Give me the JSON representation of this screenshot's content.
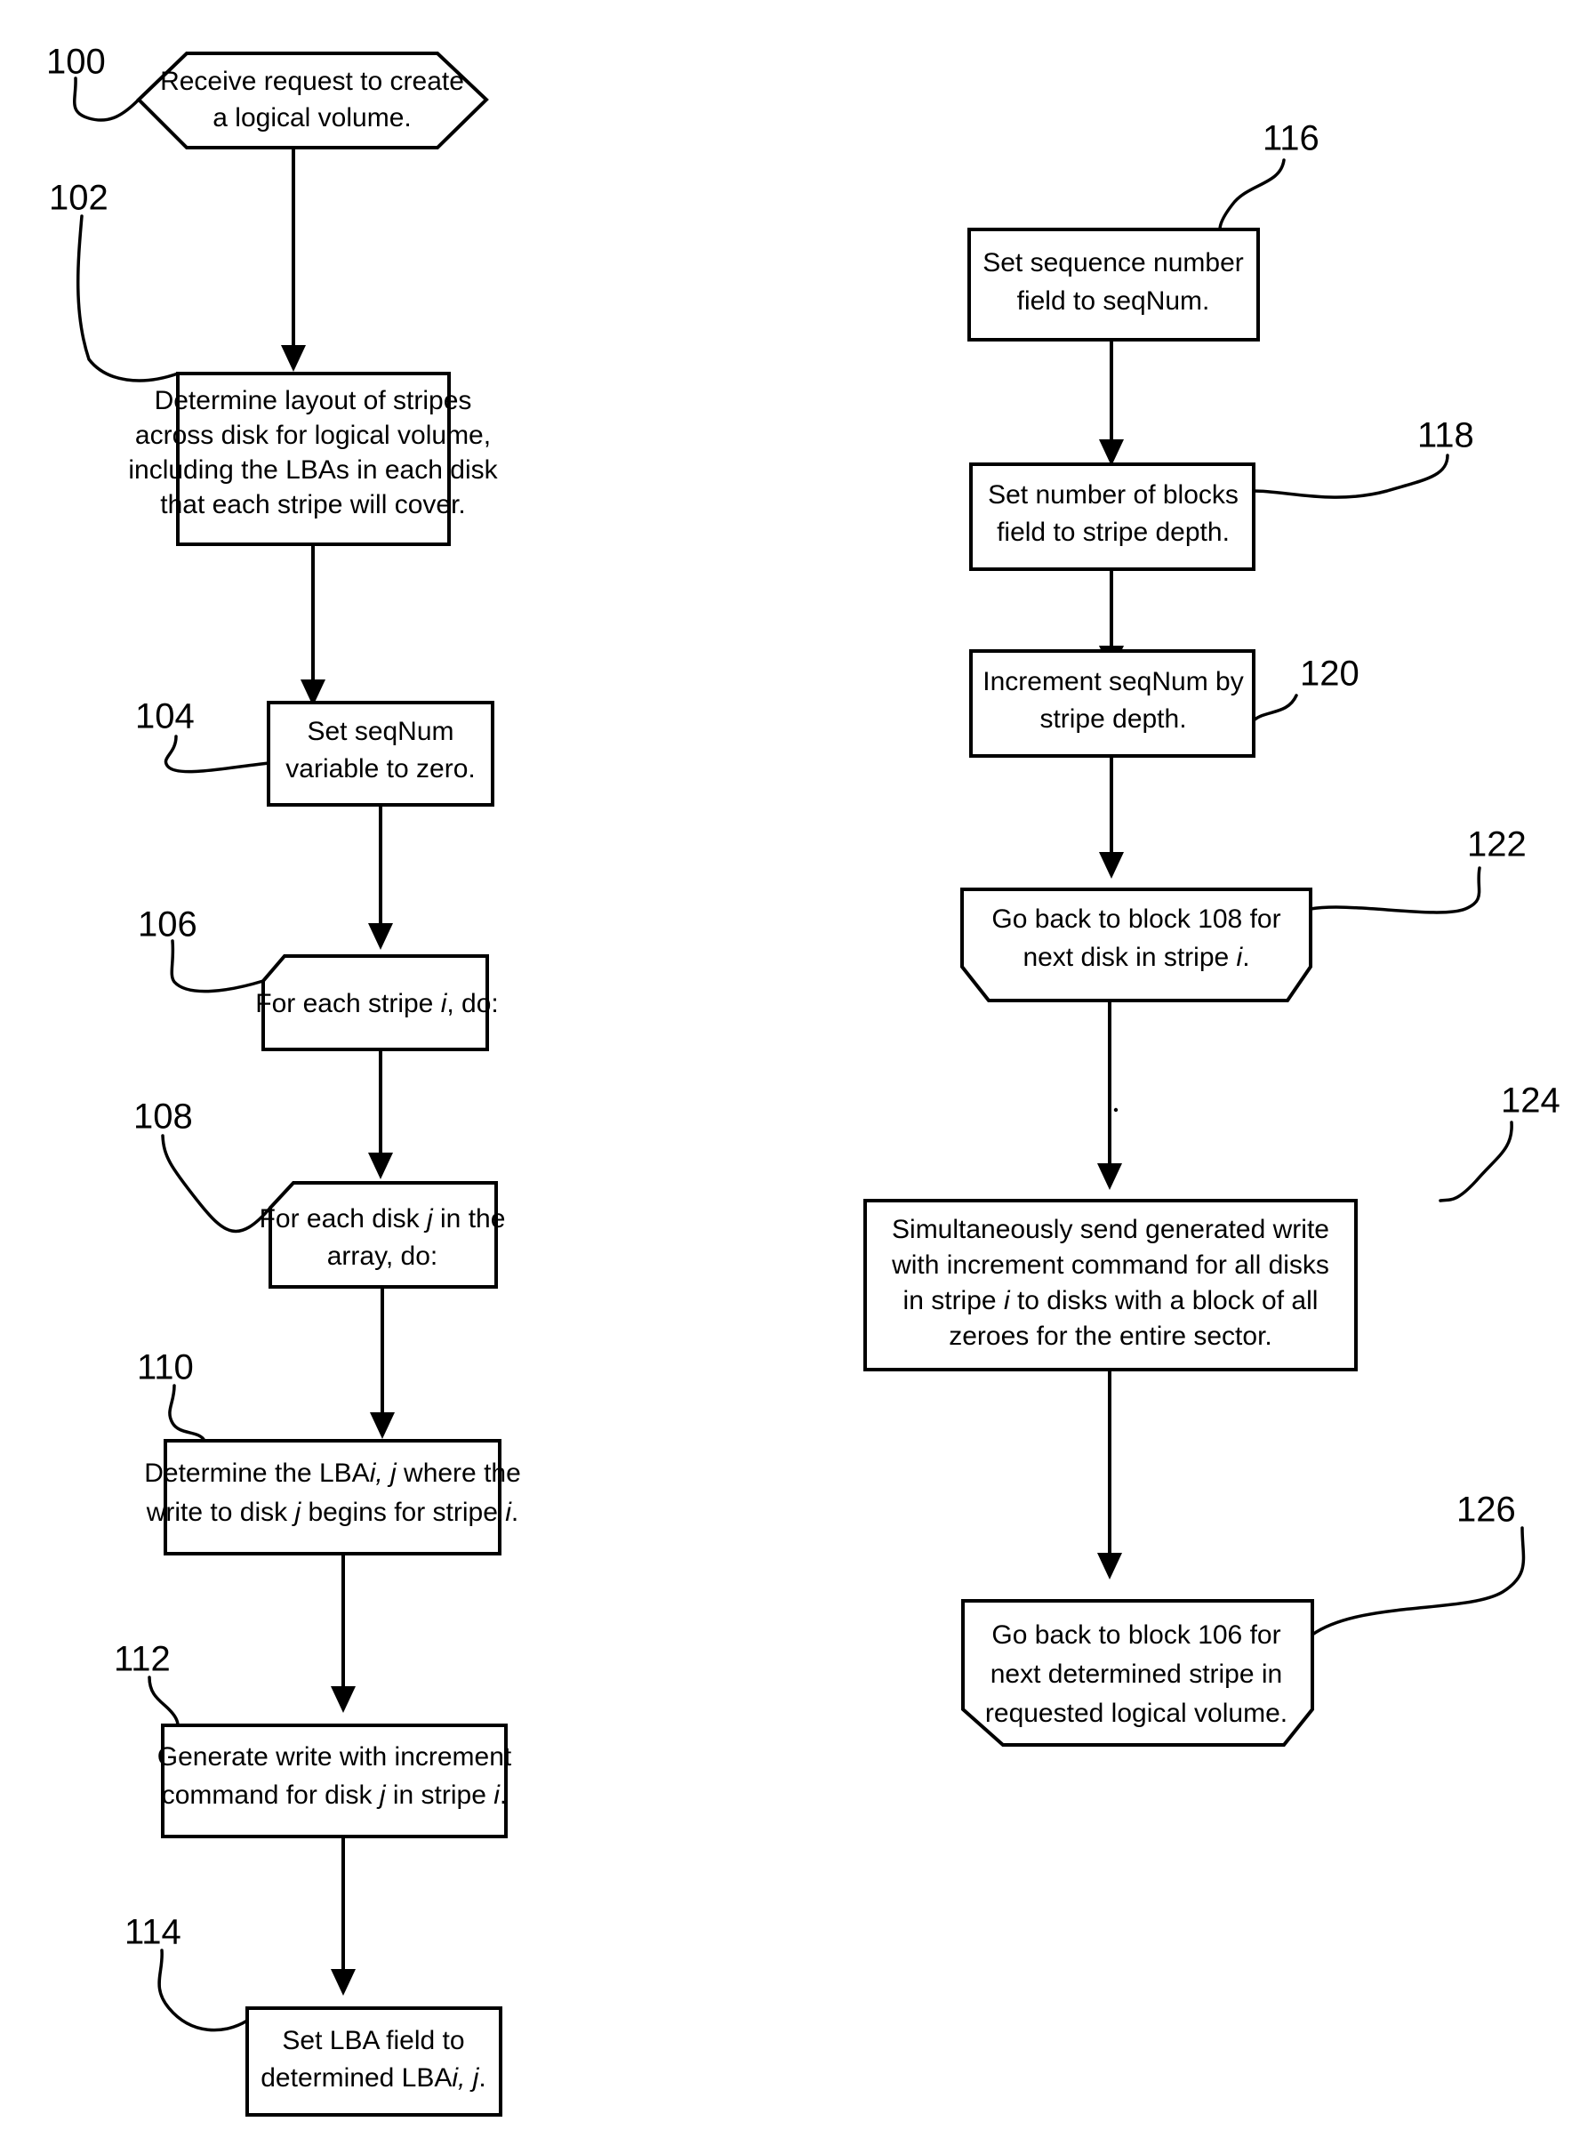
{
  "diagram": {
    "type": "flowchart",
    "title": "",
    "background_color": "#ffffff",
    "line_color": "#000000",
    "nodes": [
      {
        "ref": "100",
        "shape": "hexagon-loop-start",
        "lines": [
          "Receive request to create",
          "a logical volume."
        ]
      },
      {
        "ref": "102",
        "shape": "rectangle",
        "lines": [
          "Determine layout of stripes",
          "across disk for logical volume,",
          "including the LBAs in each disk",
          "that each stripe will cover."
        ]
      },
      {
        "ref": "104",
        "shape": "rectangle",
        "lines": [
          "Set seqNum",
          "variable  to zero."
        ]
      },
      {
        "ref": "106",
        "shape": "loop-start",
        "lines": [
          "For each stripe i, do:"
        ],
        "italic_tokens": [
          "i"
        ]
      },
      {
        "ref": "108",
        "shape": "loop-start",
        "lines": [
          "For each disk j in the",
          "array, do:"
        ],
        "italic_tokens": [
          "j"
        ]
      },
      {
        "ref": "110",
        "shape": "rectangle",
        "lines": [
          "Determine the LBAi, j where the",
          "write to disk j begins for stripe i."
        ],
        "italic_tokens": [
          "i",
          "j"
        ]
      },
      {
        "ref": "112",
        "shape": "rectangle",
        "lines": [
          "Generate write with increment",
          "command for disk j in stripe i."
        ],
        "italic_tokens": [
          "j",
          "i"
        ]
      },
      {
        "ref": "114",
        "shape": "rectangle",
        "lines": [
          "Set LBA field to",
          "determined LBAi, j."
        ],
        "italic_tokens": [
          "i",
          "j"
        ]
      },
      {
        "ref": "116",
        "shape": "rectangle",
        "lines": [
          "Set sequence number",
          "field to seqNum."
        ]
      },
      {
        "ref": "118",
        "shape": "rectangle",
        "lines": [
          "Set number of blocks",
          "field to stripe depth."
        ]
      },
      {
        "ref": "120",
        "shape": "rectangle",
        "lines": [
          "Increment seqNum by",
          "stripe depth."
        ]
      },
      {
        "ref": "122",
        "shape": "loop-end",
        "lines": [
          "Go back to block 108 for",
          "next disk in stripe i."
        ],
        "italic_tokens": [
          "i"
        ]
      },
      {
        "ref": "124",
        "shape": "rectangle",
        "lines": [
          "Simultaneously send generated write",
          "with increment command for all disks",
          "in stripe i to disks with a block of all",
          "zeroes for the entire sector."
        ],
        "italic_tokens": [
          "i"
        ]
      },
      {
        "ref": "126",
        "shape": "loop-end",
        "lines": [
          "Go back to block 106 for",
          "next determined stripe in",
          "requested logical volume."
        ]
      }
    ],
    "edges": [
      {
        "from": "100",
        "to": "102",
        "arrow": true
      },
      {
        "from": "102",
        "to": "104",
        "arrow": true
      },
      {
        "from": "104",
        "to": "106",
        "arrow": true
      },
      {
        "from": "106",
        "to": "108",
        "arrow": true
      },
      {
        "from": "108",
        "to": "110",
        "arrow": true
      },
      {
        "from": "110",
        "to": "112",
        "arrow": true
      },
      {
        "from": "112",
        "to": "114",
        "arrow": true
      },
      {
        "from": "116",
        "to": "118",
        "arrow": true
      },
      {
        "from": "118",
        "to": "120",
        "arrow": true
      },
      {
        "from": "120",
        "to": "122",
        "arrow": true
      },
      {
        "from": "122",
        "to": "124",
        "arrow": true
      },
      {
        "from": "124",
        "to": "126",
        "arrow": true
      }
    ]
  },
  "text": {
    "n100_l1": "Receive request to create",
    "n100_l2": "a logical volume.",
    "n102_l1": "Determine layout of stripes",
    "n102_l2": "across disk for logical volume,",
    "n102_l3": "including the LBAs in each disk",
    "n102_l4": "that each stripe will cover.",
    "n104_l1": "Set seqNum",
    "n104_l2": "variable  to zero.",
    "n106_a": "For each stripe ",
    "n106_i": "i",
    "n106_b": ", do:",
    "n108_a": "For each disk ",
    "n108_i": "j",
    "n108_b": " in the",
    "n108_l2": "array, do:",
    "n110_a": "Determine the LBA",
    "n110_i1": "i, j",
    "n110_b": " where the",
    "n110_c": "write to disk ",
    "n110_i2": "j",
    "n110_d": " begins for stripe ",
    "n110_i3": "i",
    "n110_e": ".",
    "n112_l1": "Generate write with increment",
    "n112_a": "command for disk ",
    "n112_i1": "j",
    "n112_b": " in stripe ",
    "n112_i2": "i",
    "n112_c": ".",
    "n114_l1": "Set LBA field to",
    "n114_a": "determined LBA",
    "n114_i": "i, j",
    "n114_b": ".",
    "n116_l1": "Set sequence number",
    "n116_l2": "field to seqNum.",
    "n118_l1": "Set number of blocks",
    "n118_l2": "field to stripe depth.",
    "n120_l1": "Increment seqNum by",
    "n120_l2": "stripe depth.",
    "n122_l1": "Go back to block 108 for",
    "n122_a": "next disk in stripe ",
    "n122_i": "i",
    "n122_b": ".",
    "n124_l1": "Simultaneously send generated write",
    "n124_l2": "with increment command for all disks",
    "n124_a": "in stripe ",
    "n124_i": "i",
    "n124_b": " to disks with a block of all",
    "n124_l4": "zeroes for the entire sector.",
    "n126_l1": "Go back to block 106 for",
    "n126_l2": "next determined stripe in",
    "n126_l3": "requested logical volume.",
    "ref100": "100",
    "ref102": "102",
    "ref104": "104",
    "ref106": "106",
    "ref108": "108",
    "ref110": "110",
    "ref112": "112",
    "ref114": "114",
    "ref116": "116",
    "ref118": "118",
    "ref120": "120",
    "ref122": "122",
    "ref124": "124",
    "ref126": "126"
  }
}
